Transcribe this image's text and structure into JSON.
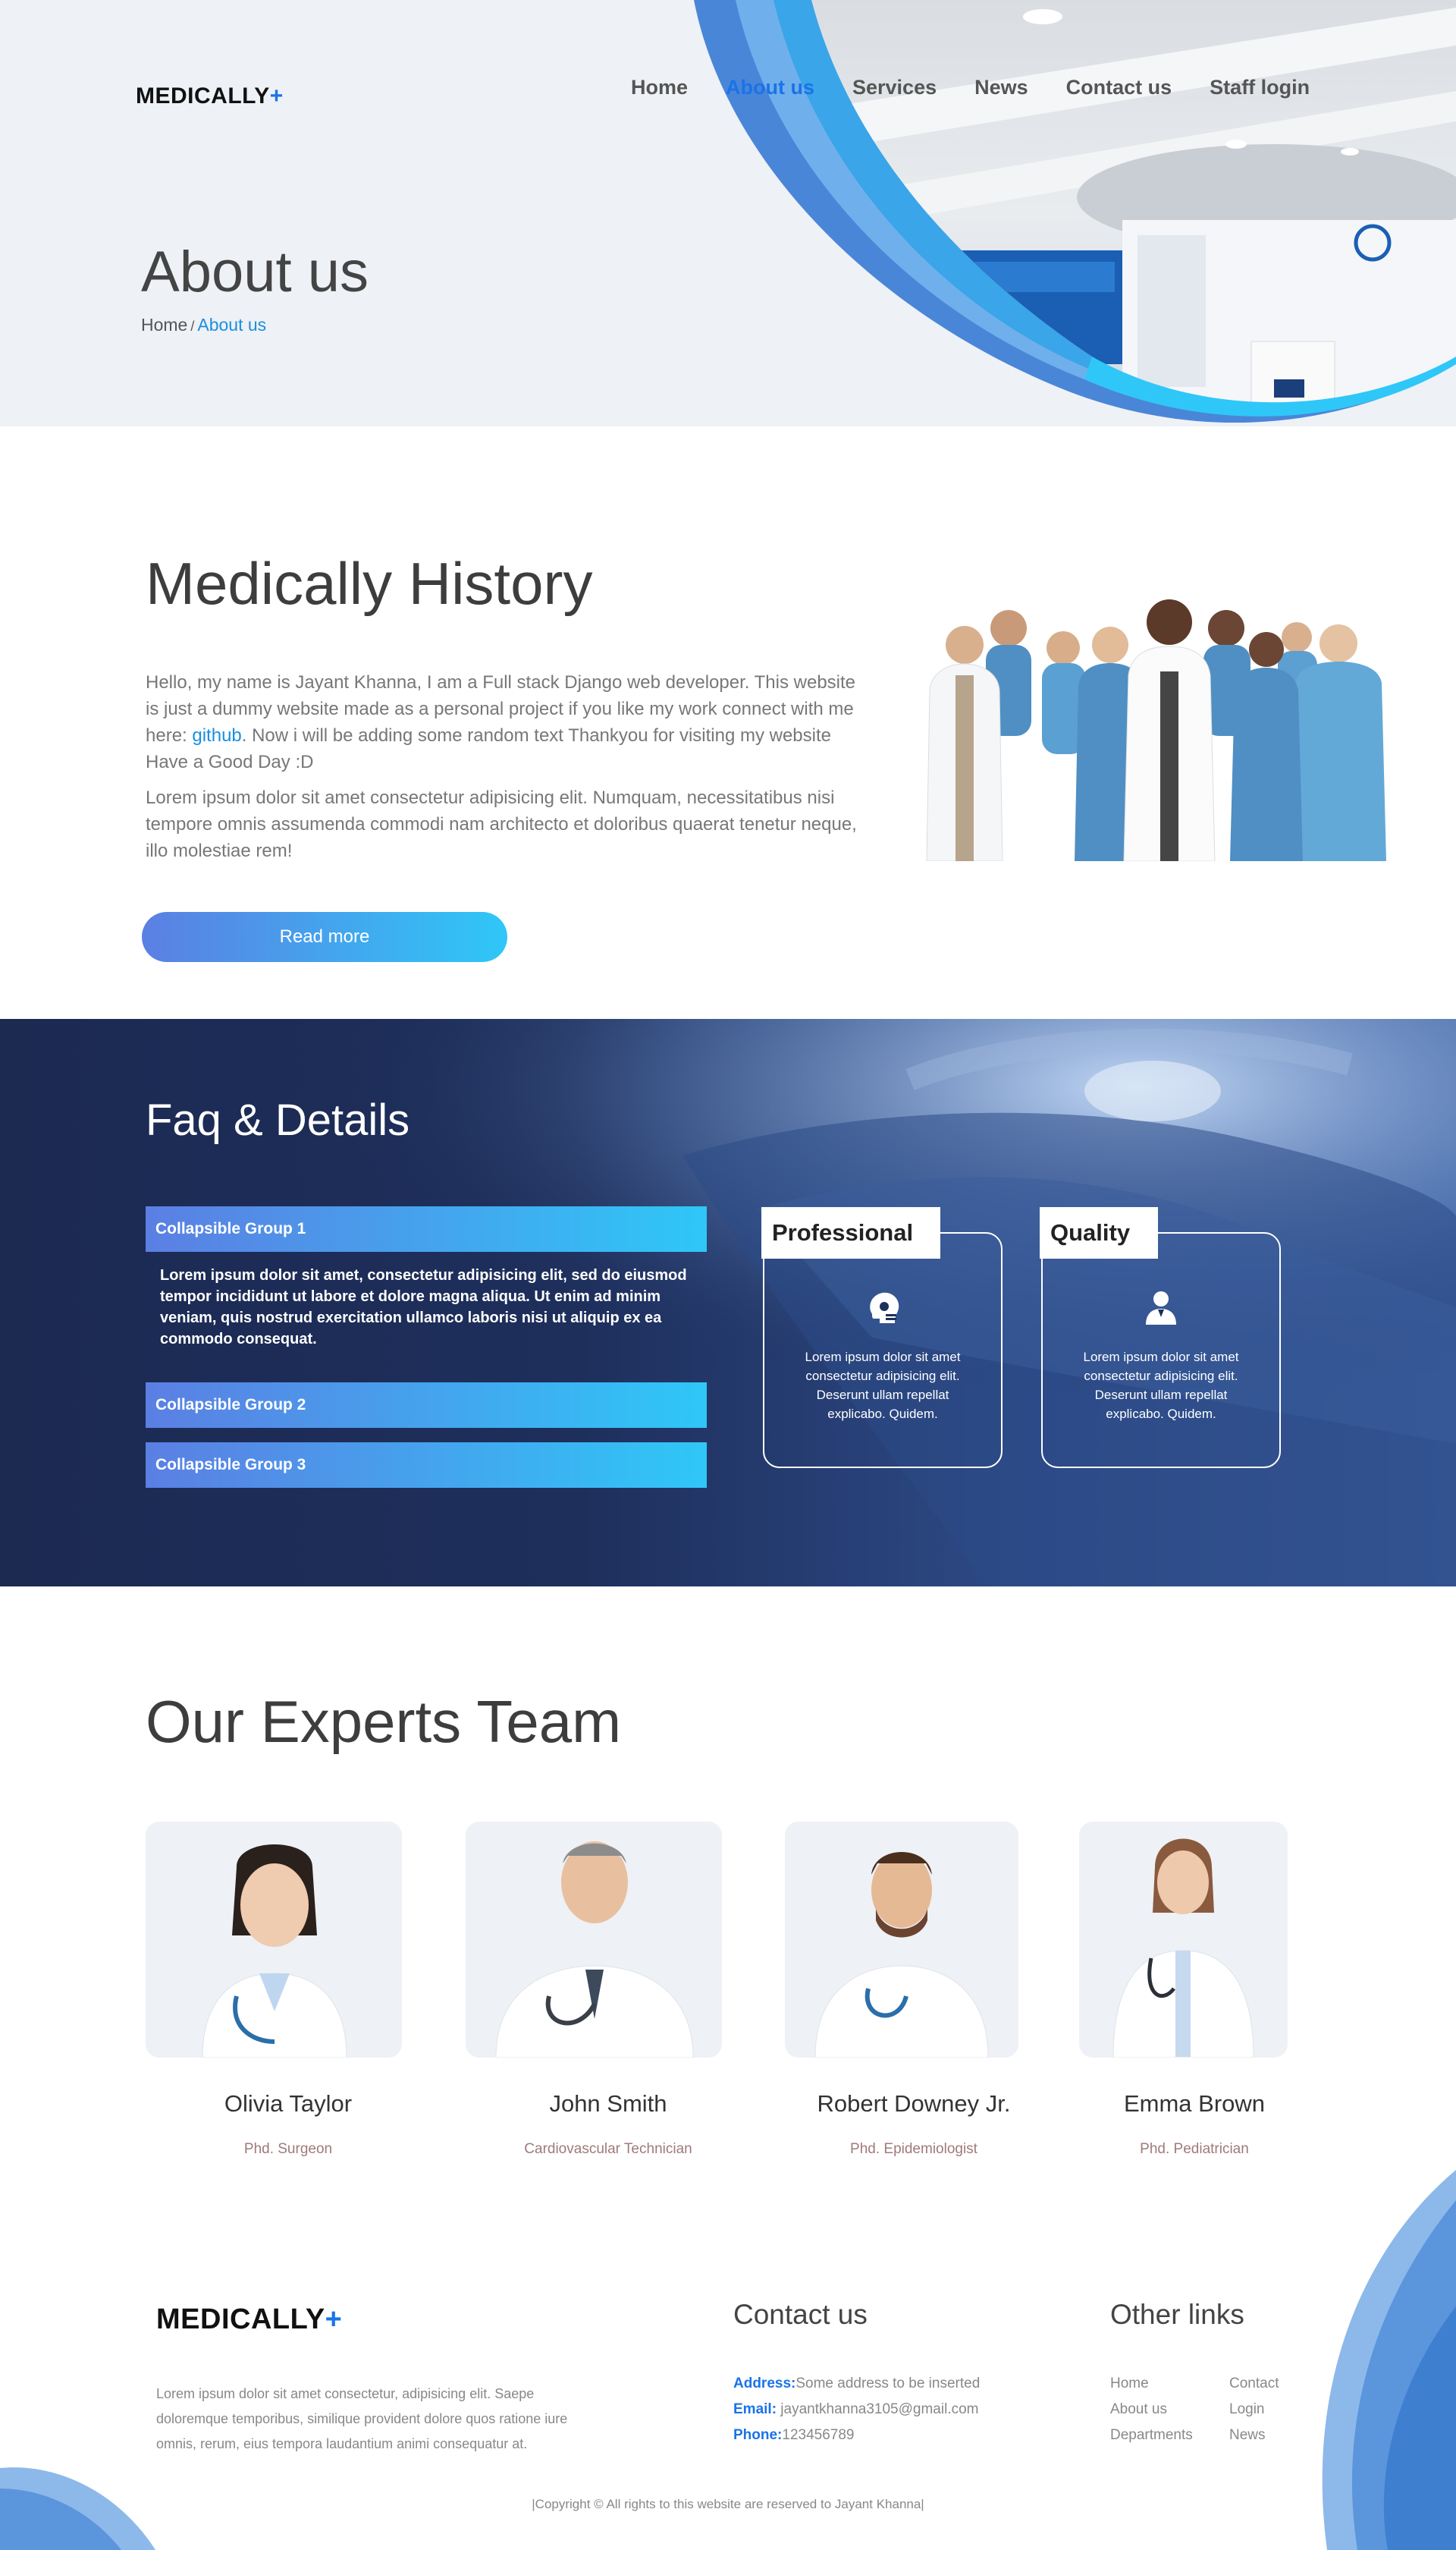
{
  "brand": {
    "name": "MEDICALLY",
    "plus": "+"
  },
  "nav": [
    {
      "label": "Home",
      "active": false
    },
    {
      "label": "About us",
      "active": true
    },
    {
      "label": "Services",
      "active": false
    },
    {
      "label": "News",
      "active": false
    },
    {
      "label": "Contact us",
      "active": false
    },
    {
      "label": "Staff login",
      "active": false
    }
  ],
  "hero": {
    "title": "About us",
    "breadcrumb": {
      "home": "Home",
      "sep": "/",
      "current": "About us"
    }
  },
  "history": {
    "title": "Medically History",
    "p1_before": "Hello, my name is Jayant Khanna, I am a Full stack Django web developer. This website is just a dummy website made as a personal project if you like my work connect with me here: ",
    "p1_link": "github",
    "p1_after": ". Now i will be adding some random text Thankyou for visiting my website Have a Good Day :D",
    "p2": "Lorem ipsum dolor sit amet consectetur adipisicing elit. Numquam, necessitatibus nisi tempore omnis assumenda commodi nam architecto et doloribus quaerat tenetur neque, illo molestiae rem!",
    "button": "Read more"
  },
  "faq": {
    "title": "Faq & Details",
    "groups": [
      {
        "label": "Collapsible Group 1",
        "body": "Lorem ipsum dolor sit amet, consectetur adipisicing elit, sed do eiusmod tempor incididunt ut labore et dolore magna aliqua. Ut enim ad minim veniam, quis nostrud exercitation ullamco laboris nisi ut aliquip ex ea commodo consequat."
      },
      {
        "label": "Collapsible Group 2"
      },
      {
        "label": "Collapsible Group 3"
      }
    ],
    "features": [
      {
        "title": "Professional",
        "icon": "head-gear-icon",
        "text": "Lorem ipsum dolor sit amet consectetur adipisicing elit. Deserunt ullam repellat explicabo. Quidem."
      },
      {
        "title": "Quality",
        "icon": "doctor-user-icon",
        "text": "Lorem ipsum dolor sit amet consectetur adipisicing elit. Deserunt ullam repellat explicabo. Quidem."
      }
    ]
  },
  "experts": {
    "title": "Our Experts Team",
    "members": [
      {
        "name": "Olivia Taylor",
        "role": "Phd. Surgeon"
      },
      {
        "name": "John Smith",
        "role": "Cardiovascular Technician"
      },
      {
        "name": "Robert Downey Jr.",
        "role": "Phd. Epidemiologist"
      },
      {
        "name": "Emma Brown",
        "role": "Phd. Pediatrician"
      }
    ]
  },
  "footer": {
    "about": "Lorem ipsum dolor sit amet consectetur, adipisicing elit. Saepe doloremque temporibus, similique provident dolore quos ratione iure omnis, rerum, eius tempora laudantium animi consequatur at.",
    "contact_title": "Contact us",
    "address_label": "Address:",
    "address": "Some address to be inserted",
    "email_label": "Email:",
    "email": " jayantkhanna3105@gmail.com",
    "phone_label": "Phone:",
    "phone": "123456789",
    "links_title": "Other links",
    "links": [
      "Home",
      "Contact",
      "About us",
      "Login",
      "Departments",
      "News"
    ],
    "copyright": "|Copyright © All rights to this website are reserved to Jayant Khanna|"
  },
  "colors": {
    "accent": "#1a73e8",
    "gradient_start": "#5b7fe3",
    "gradient_end": "#2fc7f7",
    "navy": "#1e2f5c"
  }
}
